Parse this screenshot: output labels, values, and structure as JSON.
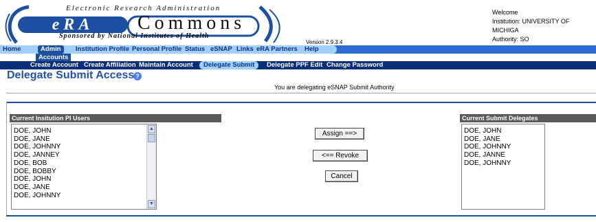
{
  "header": {
    "logo_top": "Electronic Research Administration",
    "logo_era": "eRA",
    "logo_commons": "Commons",
    "logo_bottom": "Sponsored by National Institutes of Health",
    "version": "Version 2.9.3.4"
  },
  "user": {
    "welcome": "Welcome",
    "institution": "Institution: UNIVERSITY OF MICHIGA",
    "authority": "Authority:  SO"
  },
  "nav": {
    "main": [
      "Home",
      "Admin",
      "Institution Profile",
      "Personal Profile",
      "Status",
      "eSNAP",
      "Links",
      "eRA Partners",
      "Help"
    ],
    "active_main": "Admin",
    "sub_label": "Accounts",
    "secondary": [
      "Create Account",
      "Create Affiliation",
      "Maintain Account",
      "Delegate Submit",
      "Delegate PPF Edit",
      "Change Password"
    ],
    "active_secondary": "Delegate Submit"
  },
  "page": {
    "title": "Delegate Submit Access",
    "help_icon": "question-circle-icon",
    "subtitle": "You are delegating eSNAP Submit Authority"
  },
  "left_panel": {
    "header": "Current Insitution PI Users",
    "items": [
      "DOE, JOHN",
      "DOE, JANE",
      "DOE, JOHNNY",
      "DOE, JANNEY",
      "DOE, BOB",
      "DOE, BOBBY",
      "DOE, JOHN",
      "DOE, JANE",
      "DOE, JOHNNY"
    ]
  },
  "right_panel": {
    "header": "Current Submit Delegates",
    "items": [
      "DOE, JOHN",
      "DOE, JANE",
      "DOE, JOHNNY",
      "DOE, JANNE",
      "DOE, JOHNNY"
    ]
  },
  "buttons": {
    "assign": "Assign ==>",
    "revoke": "<== Revoke",
    "cancel": "Cancel"
  },
  "colors": {
    "accent": "#1d4fa3",
    "nav_light": "#9fd0ff",
    "nav_dark": "#0a2f7a",
    "panel_header": "#5a5a5a"
  }
}
